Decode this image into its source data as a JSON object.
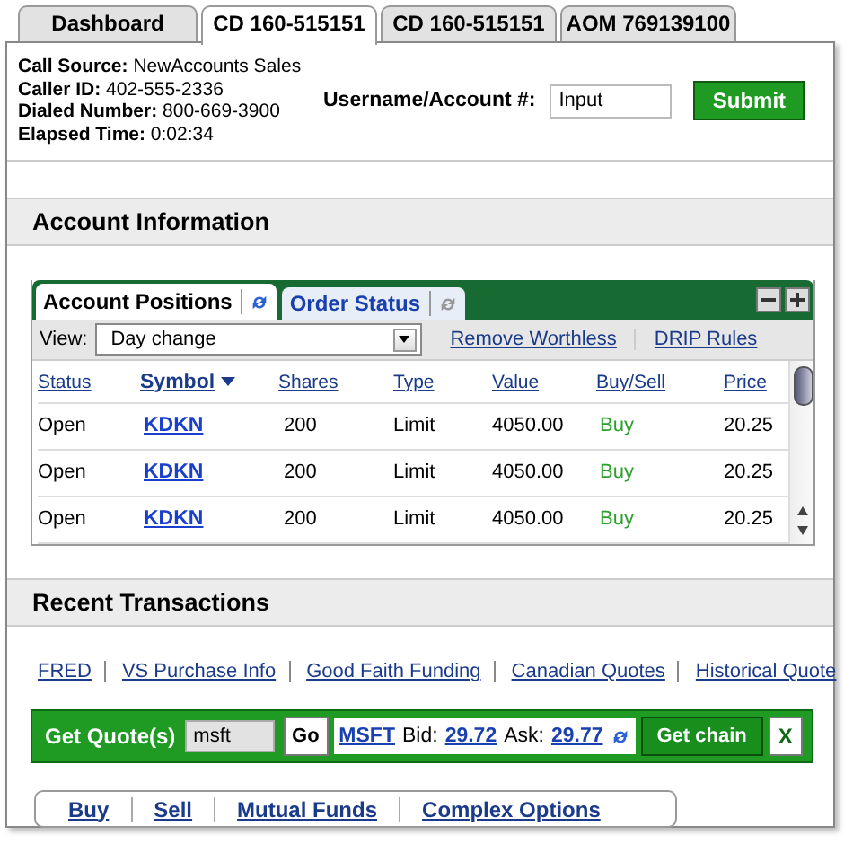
{
  "tabs": [
    {
      "label": "Dashboard",
      "selected": false
    },
    {
      "label": "CD 160-515151",
      "selected": true
    },
    {
      "label": "CD 160-515151",
      "selected": false
    },
    {
      "label": "AOM 769139100",
      "selected": false
    }
  ],
  "caller_info": [
    {
      "label": "Call Source:",
      "value": "NewAccounts Sales"
    },
    {
      "label": "Caller ID:",
      "value": "402-555-2336"
    },
    {
      "label": "Dialed Number:",
      "value": "800-669-3900"
    },
    {
      "label": "Elapsed Time:",
      "value": "0:02:34"
    }
  ],
  "account_search": {
    "label": "Username/Account #:",
    "value": "Input",
    "button": "Submit"
  },
  "account_information": {
    "title": "Account Information",
    "widget": {
      "tabs": [
        {
          "label": "Account Positions",
          "selected": true
        },
        {
          "label": "Order Status",
          "selected": false
        }
      ],
      "view": {
        "label": "View:",
        "value": "Day change"
      },
      "links": [
        "Remove Worthless",
        "DRIP Rules"
      ],
      "columns": [
        {
          "label": "Status",
          "sorted": false
        },
        {
          "label": "Symbol",
          "sorted": true
        },
        {
          "label": "Shares",
          "sorted": false
        },
        {
          "label": "Type",
          "sorted": false
        },
        {
          "label": "Value",
          "sorted": false
        },
        {
          "label": "Buy/Sell",
          "sorted": false
        },
        {
          "label": "Price",
          "sorted": false
        }
      ],
      "rows": [
        {
          "status": "Open",
          "symbol": "KDKN",
          "shares": "200",
          "type": "Limit",
          "value": "4050.00",
          "buy_sell": "Buy",
          "price": "20.25"
        },
        {
          "status": "Open",
          "symbol": "KDKN",
          "shares": "200",
          "type": "Limit",
          "value": "4050.00",
          "buy_sell": "Buy",
          "price": "20.25"
        },
        {
          "status": "Open",
          "symbol": "KDKN",
          "shares": "200",
          "type": "Limit",
          "value": "4050.00",
          "buy_sell": "Buy",
          "price": "20.25"
        }
      ]
    }
  },
  "recent_transactions": {
    "title": "Recent Transactions",
    "links": [
      "FRED",
      "VS Purchase Info",
      "Good Faith Funding",
      "Canadian Quotes",
      "Historical Quote"
    ],
    "quote_bar": {
      "label": "Get Quote(s)",
      "value": "msft",
      "go_button": "Go",
      "symbol": "MSFT",
      "bid_label": "Bid:",
      "bid": "29.72",
      "ask_label": "Ask:",
      "ask": "29.77",
      "chain_button": "Get chain",
      "close_button": "X"
    },
    "actions": [
      "Buy",
      "Sell",
      "Mutual Funds",
      "Complex Options"
    ]
  }
}
